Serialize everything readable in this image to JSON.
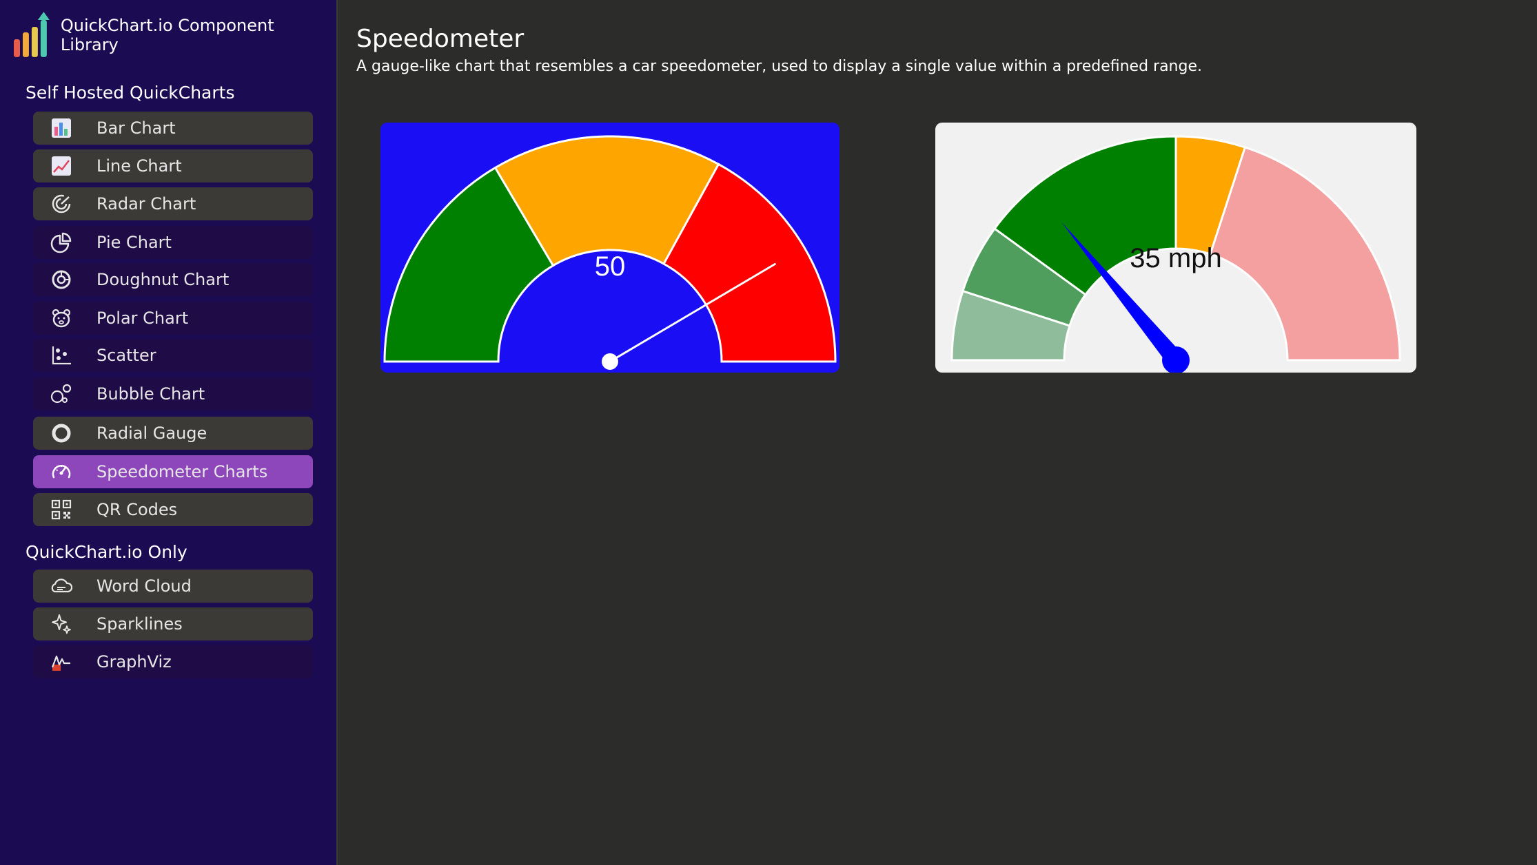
{
  "app": {
    "title": "QuickChart.io Component Library"
  },
  "sidebar": {
    "sections": [
      {
        "title": "Self Hosted QuickCharts",
        "items": [
          {
            "label": "Bar Chart",
            "icon": "bar-chart-icon"
          },
          {
            "label": "Line Chart",
            "icon": "line-chart-icon"
          },
          {
            "label": "Radar Chart",
            "icon": "radar-chart-icon"
          },
          {
            "label": "Pie Chart",
            "icon": "pie-chart-icon"
          },
          {
            "label": "Doughnut Chart",
            "icon": "doughnut-chart-icon"
          },
          {
            "label": "Polar Chart",
            "icon": "polar-chart-icon"
          },
          {
            "label": "Scatter",
            "icon": "scatter-icon"
          },
          {
            "label": "Bubble Chart",
            "icon": "bubble-chart-icon"
          },
          {
            "label": "Radial Gauge",
            "icon": "radial-gauge-icon"
          },
          {
            "label": "Speedometer Charts",
            "icon": "speedometer-icon",
            "active": true
          },
          {
            "label": "QR Codes",
            "icon": "qr-code-icon"
          }
        ]
      },
      {
        "title": "QuickChart.io Only",
        "items": [
          {
            "label": "Word Cloud",
            "icon": "cloud-icon"
          },
          {
            "label": "Sparklines",
            "icon": "sparkles-icon"
          },
          {
            "label": "GraphViz",
            "icon": "graphviz-icon"
          }
        ]
      }
    ]
  },
  "main": {
    "title": "Speedometer",
    "description": "A gauge-like chart that resembles a car speedometer, used to display a single value within a predefined range."
  },
  "chart_data": [
    {
      "type": "gauge",
      "value": 50,
      "value_label": "50",
      "range": [
        0,
        100
      ],
      "bands": [
        {
          "from": 0,
          "to": 33,
          "color": "#008000"
        },
        {
          "from": 33,
          "to": 66,
          "color": "#ffa500"
        },
        {
          "from": 66,
          "to": 100,
          "color": "#ff0000"
        }
      ],
      "needle_value": 83,
      "background": "#1a0ef4",
      "needle_color": "#ffffff"
    },
    {
      "type": "gauge",
      "value": 35,
      "value_label": "35 mph",
      "range": [
        0,
        100
      ],
      "bands": [
        {
          "from": 0,
          "to": 10,
          "color": "#8fbc9a"
        },
        {
          "from": 10,
          "to": 20,
          "color": "#4f9e5e"
        },
        {
          "from": 20,
          "to": 50,
          "color": "#008000"
        },
        {
          "from": 50,
          "to": 60,
          "color": "#ffa500"
        },
        {
          "from": 60,
          "to": 100,
          "color": "#f4a0a0"
        }
      ],
      "needle_value": 28,
      "background": "#f1f1f1",
      "needle_color": "#0000ff"
    }
  ]
}
